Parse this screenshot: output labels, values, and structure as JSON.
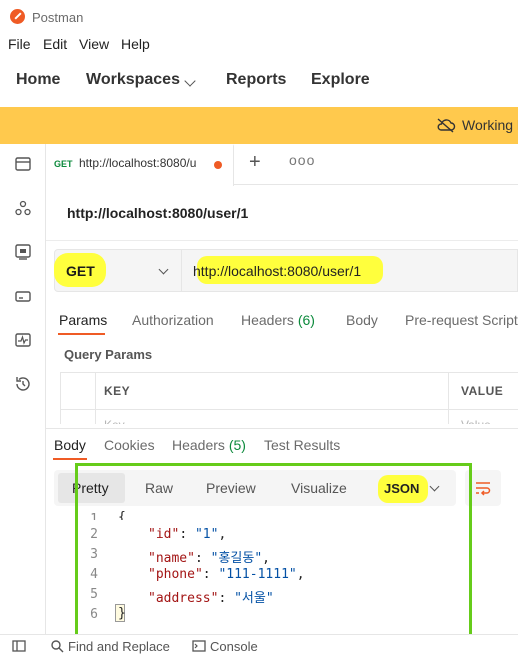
{
  "app": {
    "title": "Postman",
    "logo_icon": "postman-logo-icon"
  },
  "menu": {
    "items": [
      "File",
      "Edit",
      "View",
      "Help"
    ]
  },
  "nav": {
    "home": "Home",
    "workspaces": "Workspaces",
    "reports": "Reports",
    "explore": "Explore"
  },
  "banner": {
    "text": "Working l",
    "icon": "cloud-off-icon",
    "color": "#ffc94d"
  },
  "sidebar": {
    "icons": [
      "collections-icon",
      "apis-icon",
      "environments-icon",
      "mock-servers-icon",
      "monitors-icon",
      "history-icon"
    ]
  },
  "tab": {
    "method": "GET",
    "url": "http://localhost:8080/u",
    "unsaved_dot_color": "#ef5b25",
    "new_tab_label": "+",
    "more_label": "ooo"
  },
  "request": {
    "title": "http://localhost:8080/user/1",
    "method": "GET",
    "url": "http://localhost:8080/user/1",
    "tabs": {
      "params": "Params",
      "authorization": "Authorization",
      "headers": "Headers",
      "headers_count": "(6)",
      "body": "Body",
      "prerequest": "Pre-request Script"
    },
    "query_params_title": "Query Params",
    "table": {
      "key_header": "KEY",
      "value_header": "VALUE",
      "key_placeholder": "Key",
      "value_placeholder": "Value"
    }
  },
  "response": {
    "tabs": {
      "body": "Body",
      "cookies": "Cookies",
      "headers": "Headers",
      "headers_count": "(5)",
      "test_results": "Test Results"
    },
    "formats": {
      "pretty": "Pretty",
      "raw": "Raw",
      "preview": "Preview",
      "visualize": "Visualize"
    },
    "language": "JSON",
    "lines": [
      {
        "n": "1",
        "key": "",
        "value": "",
        "pre": "{"
      },
      {
        "n": "2",
        "key": "\"id\"",
        "value": "\"1\"",
        "sep": ": ",
        "post": ","
      },
      {
        "n": "3",
        "key": "\"name\"",
        "value": "\"홍길동\"",
        "sep": ": ",
        "post": ","
      },
      {
        "n": "4",
        "key": "\"phone\"",
        "value": "\"111-1111\"",
        "sep": ": ",
        "post": ","
      },
      {
        "n": "5",
        "key": "\"address\"",
        "value": "\"서울\"",
        "sep": ": ",
        "post": ""
      },
      {
        "n": "6",
        "key": "",
        "value": "",
        "pre": "}"
      }
    ]
  },
  "footer": {
    "find_replace": "Find and Replace",
    "console": "Console"
  },
  "colors": {
    "accent": "#ef5b25",
    "highlight": "#ffff3d",
    "annotation_frame": "#66cc1a",
    "success": "#0c8a3c"
  }
}
